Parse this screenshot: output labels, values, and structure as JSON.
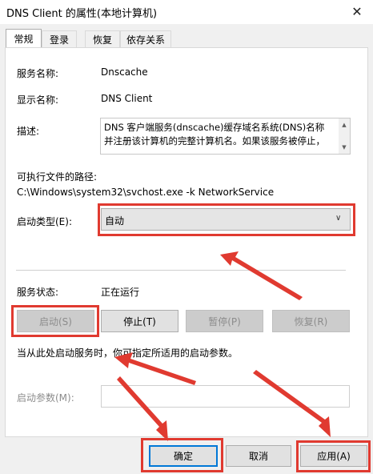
{
  "window": {
    "title": "DNS Client 的属性(本地计算机)",
    "close_glyph": "✕"
  },
  "tabs": [
    {
      "label": "常规"
    },
    {
      "label": "登录"
    },
    {
      "label": "恢复"
    },
    {
      "label": "依存关系"
    }
  ],
  "general": {
    "service_name_label": "服务名称:",
    "service_name": "Dnscache",
    "display_name_label": "显示名称:",
    "display_name": "DNS Client",
    "description_label": "描述:",
    "description_line1": "DNS 客户端服务(dnscache)缓存域名系统(DNS)名称",
    "description_line2": "并注册该计算机的完整计算机名。如果该服务被停止，",
    "exe_path_label": "可执行文件的路径:",
    "exe_path": "C:\\Windows\\system32\\svchost.exe -k NetworkService",
    "startup_type_label": "启动类型(E):",
    "startup_type_value": "自动",
    "service_status_label": "服务状态:",
    "service_status_value": "正在运行",
    "start_button": "启动(S)",
    "stop_button": "停止(T)",
    "pause_button": "暂停(P)",
    "resume_button": "恢复(R)",
    "hint_text": "当从此处启动服务时，你可指定所适用的启动参数。",
    "start_params_label": "启动参数(M):",
    "start_params_value": ""
  },
  "footer": {
    "ok_button": "确定",
    "cancel_button": "取消",
    "apply_button": "应用(A)"
  },
  "annotation_color": "#e03a30",
  "accent_color": "#0078d7"
}
